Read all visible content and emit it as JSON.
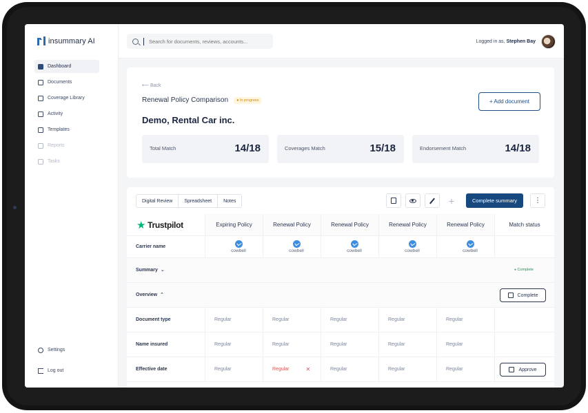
{
  "app": {
    "logo_text": "insummary AI"
  },
  "sidebar": {
    "items": [
      {
        "label": "Dashboard"
      },
      {
        "label": "Documents"
      },
      {
        "label": "Coverage Library"
      },
      {
        "label": "Activity"
      },
      {
        "label": "Templates"
      },
      {
        "label": "Reports"
      },
      {
        "label": "Tasks"
      }
    ],
    "settings_label": "Settings",
    "logout_label": "Log out"
  },
  "topbar": {
    "search_placeholder": "Search for documents, reviews, accounts...",
    "logged_in_prefix": "Logged in as,",
    "user_name": "Stephen Bay"
  },
  "summary": {
    "back_label": "Back",
    "title": "Renewal Policy Comparison",
    "status_badge": "In progress",
    "company": "Demo, Rental Car inc.",
    "add_document_label": "+ Add document",
    "stats": [
      {
        "label": "Total Match",
        "value": "14/18"
      },
      {
        "label": "Coverages Match",
        "value": "15/18"
      },
      {
        "label": "Endorsement Match",
        "value": "14/18"
      }
    ]
  },
  "comparison": {
    "tabs": [
      "Digital Review",
      "Spreadsheet",
      "Notes"
    ],
    "complete_summary_label": "Complete summary",
    "brand_label": "Trustpilot",
    "columns": [
      "Expiring Policy",
      "Renewal Policy",
      "Renewal Policy",
      "Renewal Policy",
      "Renewal Policy",
      "Match status"
    ],
    "carrier_row_label": "Carrier name",
    "carrier_name": "cowbell",
    "summary_section": {
      "label": "Summary",
      "status": "Complete"
    },
    "overview_section": {
      "label": "Overview",
      "action_label": "Complete"
    },
    "rows": [
      {
        "label": "Document type",
        "cells": [
          "Regular",
          "Regular",
          "Regular",
          "Regular",
          "Regular"
        ]
      },
      {
        "label": "Name insured",
        "cells": [
          "Regular",
          "Regular",
          "Regular",
          "Regular",
          "Regular"
        ]
      },
      {
        "label": "Effective date",
        "cells": [
          "Regular",
          "Regular",
          "Regular",
          "Regular",
          "Regular"
        ],
        "action_label": "Approve"
      }
    ]
  },
  "colors": {
    "primary": "#17497f",
    "accent_green": "#00b67a",
    "warning": "#c8891e",
    "error": "#d9534f"
  }
}
